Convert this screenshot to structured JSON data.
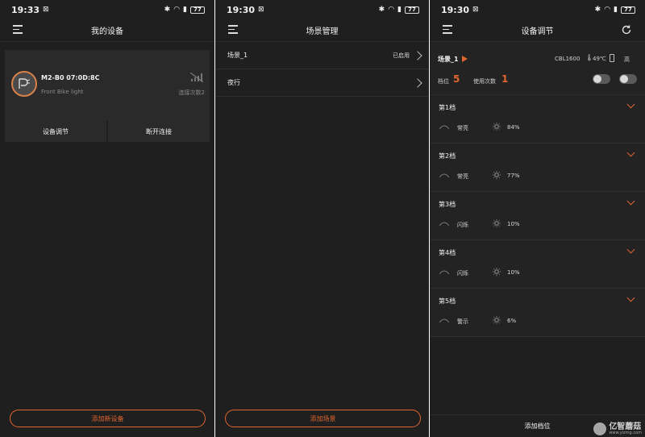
{
  "screen1": {
    "status": {
      "time": "19:33",
      "battery": "77"
    },
    "title": "我的设备",
    "device": {
      "name": "M2-B0 07:0D:8C",
      "subtitle": "Front Bike light",
      "connect_count": "连接次数2"
    },
    "buttons": {
      "adjust": "设备调节",
      "disconnect": "断开连接"
    },
    "add_button": "添加新设备"
  },
  "screen2": {
    "status": {
      "time": "19:30",
      "battery": "77"
    },
    "title": "场景管理",
    "scenes": [
      {
        "name": "场景_1",
        "status": "已启用"
      },
      {
        "name": "夜行",
        "status": ""
      }
    ],
    "add_button": "添加场景"
  },
  "screen3": {
    "status": {
      "time": "19:30",
      "battery": "77"
    },
    "title": "设备调节",
    "scene_name": "场景_1",
    "lamp_model": "CBL1600",
    "temperature": "49℃",
    "battery_level": "高",
    "gear_label": "档位",
    "gear_value": "5",
    "use_label": "使用次数",
    "use_value": "1",
    "gears": [
      {
        "name": "第1档",
        "mode": "常亮",
        "brightness": "84%"
      },
      {
        "name": "第2档",
        "mode": "常亮",
        "brightness": "77%"
      },
      {
        "name": "第3档",
        "mode": "闪烁",
        "brightness": "10%"
      },
      {
        "name": "第4档",
        "mode": "闪烁",
        "brightness": "10%"
      },
      {
        "name": "第5档",
        "mode": "警示",
        "brightness": "6%"
      }
    ],
    "add_button": "添加档位",
    "watermark": {
      "text": "亿智蘑菇",
      "url": "www.yizmg.com"
    }
  },
  "colors": {
    "accent": "#e0652e",
    "background": "#1f1f1f",
    "card": "#2a2a2a"
  }
}
